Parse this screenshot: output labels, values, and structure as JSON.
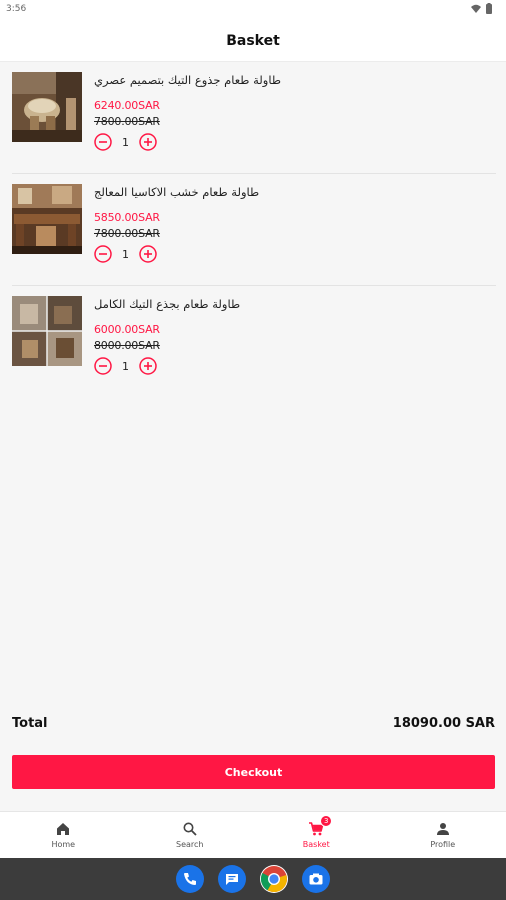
{
  "status_bar": {
    "time": "3:56"
  },
  "app_bar": {
    "title": "Basket"
  },
  "items": [
    {
      "name": "طاولة طعام جذوع التيك بتصميم عصري",
      "sale_price": "6240.00SAR",
      "old_price": "7800.00SAR",
      "quantity": "1"
    },
    {
      "name": "طاولة طعام خشب الاكاسيا المعالج",
      "sale_price": "5850.00SAR",
      "old_price": "7800.00SAR",
      "quantity": "1"
    },
    {
      "name": "طاولة طعام بجذع التيك الكامل",
      "sale_price": "6000.00SAR",
      "old_price": "8000.00SAR",
      "quantity": "1"
    }
  ],
  "summary": {
    "total_label": "Total",
    "total_value": "18090.00 SAR"
  },
  "checkout": {
    "label": "Checkout"
  },
  "bottom_nav": {
    "home": "Home",
    "search": "Search",
    "basket": "Basket",
    "basket_badge": "3",
    "profile": "Profile"
  },
  "colors": {
    "accent": "#ff1744",
    "background": "#f6f6f6",
    "system_bar": "#3c3c3c"
  },
  "icons": [
    "wifi-icon",
    "battery-icon",
    "minus-icon",
    "plus-icon",
    "home-icon",
    "search-icon",
    "cart-icon",
    "person-icon",
    "phone-icon",
    "messages-icon",
    "chrome-icon",
    "camera-icon"
  ]
}
